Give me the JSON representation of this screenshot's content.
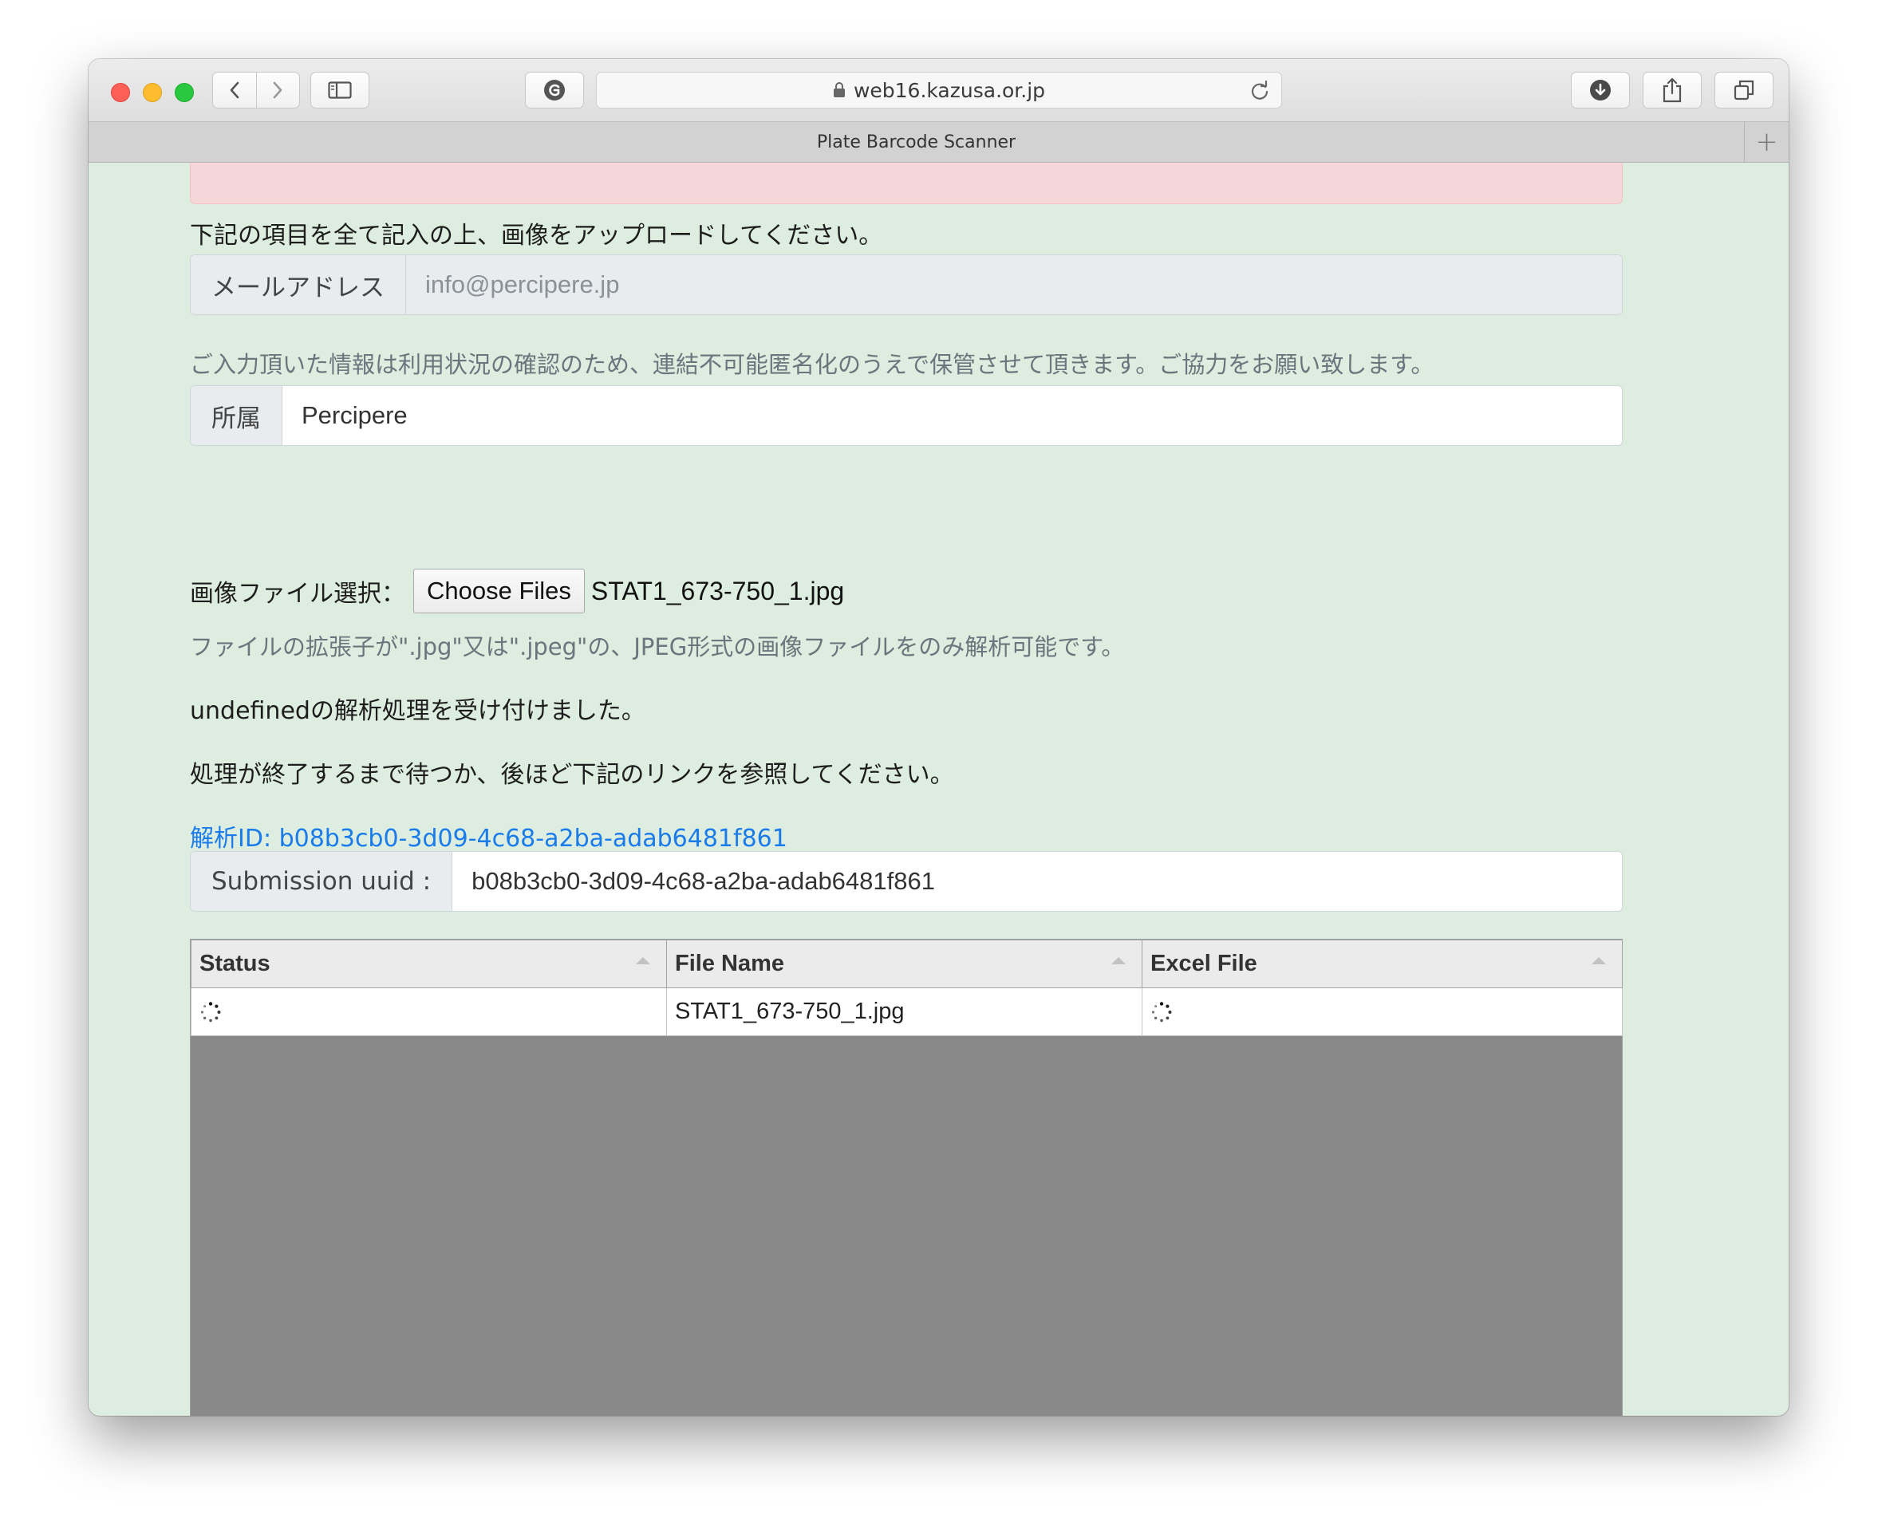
{
  "browser": {
    "url": "web16.kazusa.or.jp",
    "tab_title": "Plate Barcode Scanner",
    "new_tab_label": "+"
  },
  "form": {
    "instruction": "下記の項目を全て記入の上、画像をアップロードしてください。",
    "email_label": "メールアドレス",
    "email_value": "info@percipere.jp",
    "privacy_note": "ご入力頂いた情報は利用状況の確認のため、連結不可能匿名化のうえで保管させて頂きます。ご協力をお願い致します。",
    "affiliation_label": "所属",
    "affiliation_value": "Percipere",
    "file_select_label": "画像ファイル選択：",
    "choose_files_label": "Choose Files",
    "selected_file": "STAT1_673-750_1.jpg",
    "file_note": "ファイルの拡張子が\".jpg\"又は\".jpeg\"の、JPEG形式の画像ファイルをのみ解析可能です。"
  },
  "status": {
    "accepted_message": "undefinedの解析処理を受け付けました。",
    "wait_message": "処理が終了するまで待つか、後ほど下記のリンクを参照してください。",
    "analysis_link": "解析ID: b08b3cb0-3d09-4c68-a2ba-adab6481f861",
    "submission_label": "Submission uuid :",
    "submission_value": "b08b3cb0-3d09-4c68-a2ba-adab6481f861"
  },
  "table": {
    "columns": [
      "Status",
      "File Name",
      "Excel File"
    ],
    "rows": [
      {
        "status": "loading-spinner-icon",
        "file_name": "STAT1_673-750_1.jpg",
        "excel_file": "loading-spinner-icon"
      }
    ]
  },
  "colors": {
    "page_bg": "#ddeddf",
    "alert_bg": "#f6d7d9",
    "link": "#1a7bea",
    "footer_line": "#2e9b68",
    "table_empty_bg": "#898989"
  }
}
